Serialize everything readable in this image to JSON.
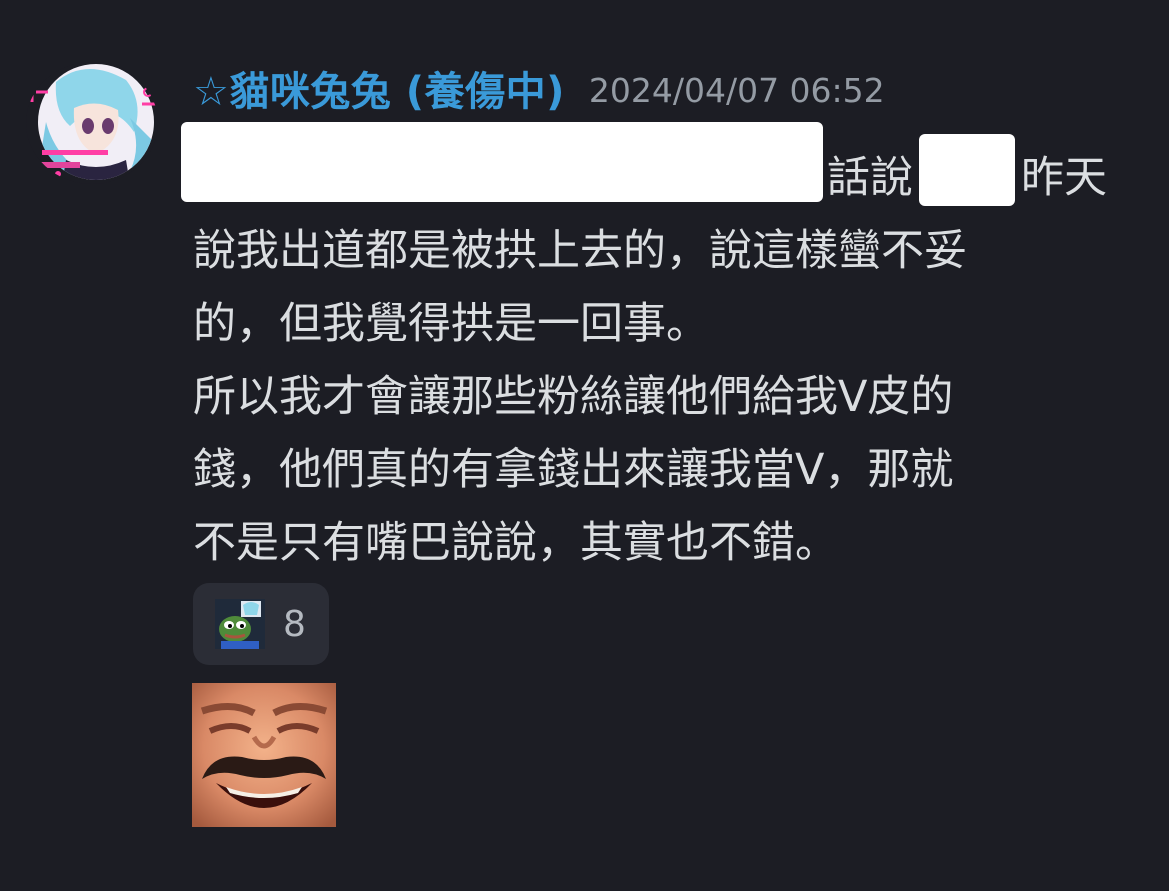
{
  "message": {
    "author": {
      "username": "☆貓咪兔兔 (養傷中)",
      "color": "#3a9ad9"
    },
    "timestamp": "2024/04/07 06:52",
    "content": {
      "line1_a": "話說",
      "line1_b": "昨天",
      "line2": "說我出道都是被拱上去的，說這樣蠻不妥",
      "line3": "的，但我覺得拱是一回事。",
      "line4": "所以我才會讓那些粉絲讓他們給我V皮的",
      "line5": "錢，他們真的有拿錢出來讓我當V，那就",
      "line6": "不是只有嘴巴說說，其實也不錯。"
    },
    "reaction": {
      "emoji": "pepe-emoji",
      "count": "8"
    },
    "sticker": "laughing-man-sticker"
  }
}
